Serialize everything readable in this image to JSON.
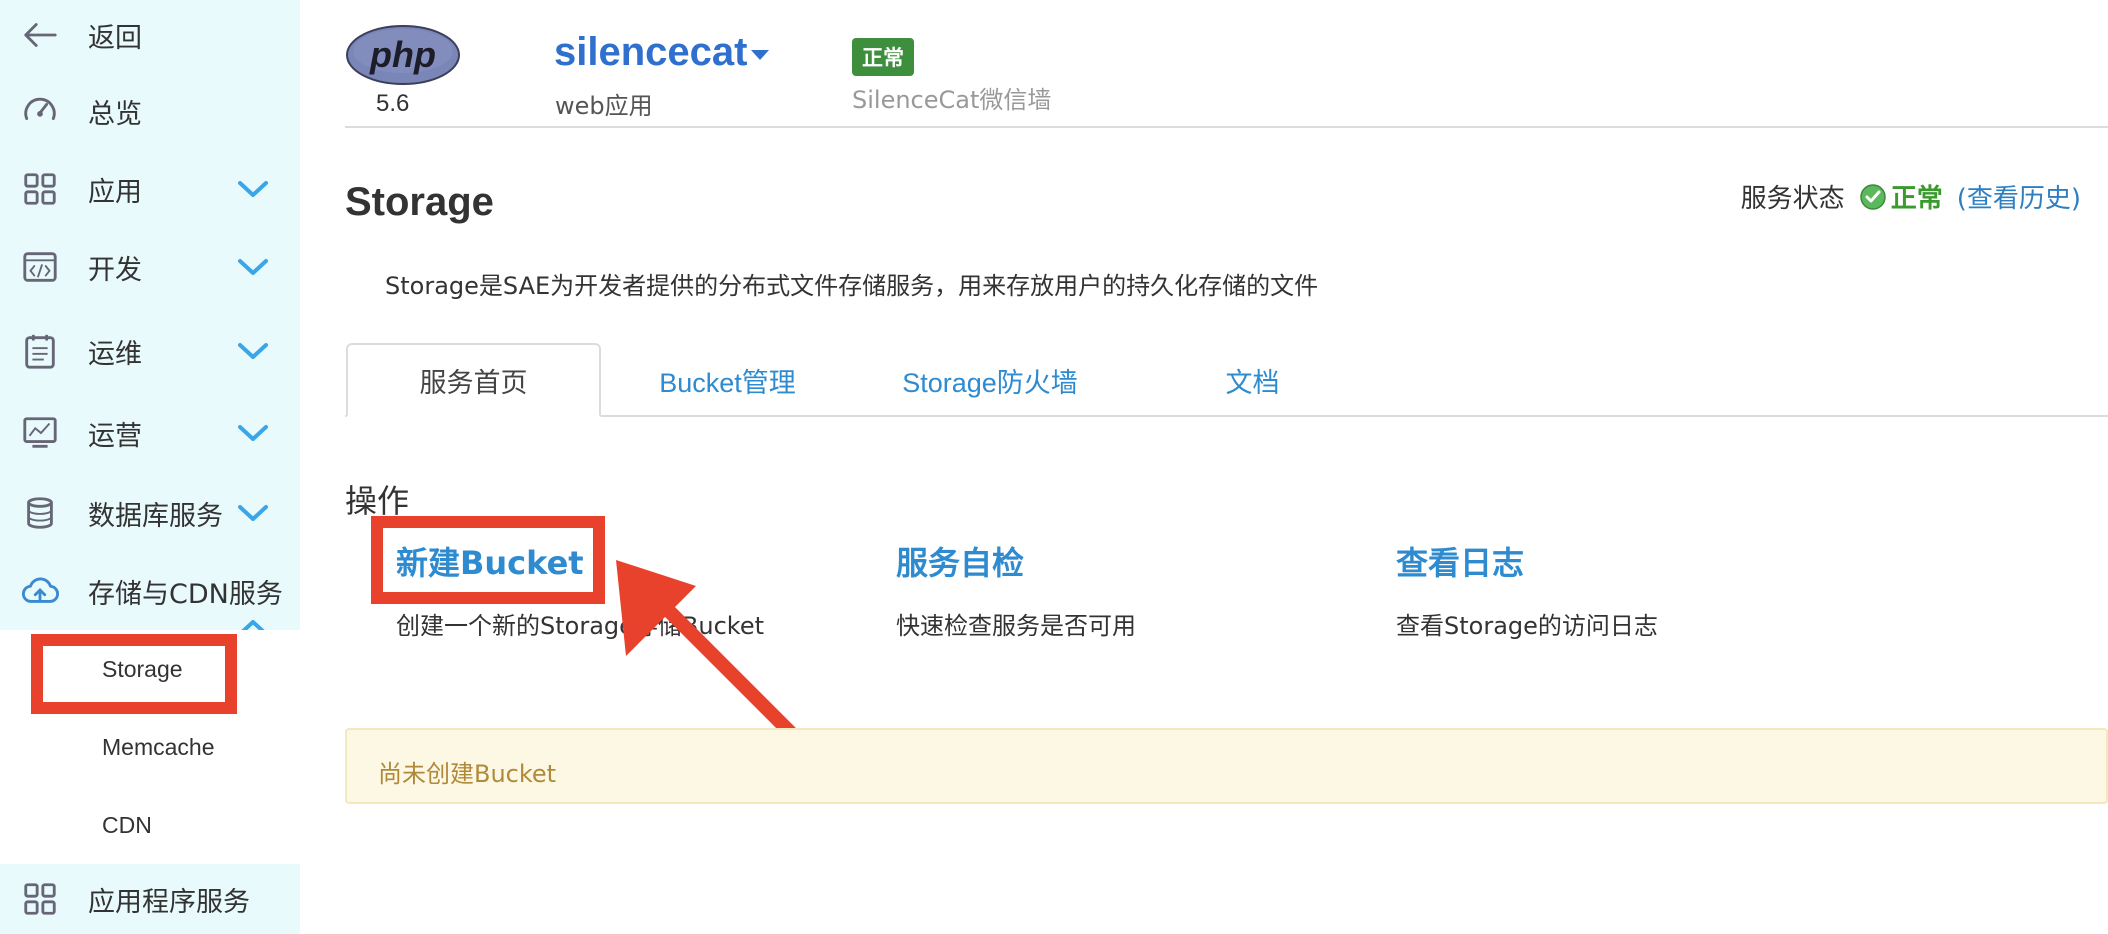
{
  "sidebar": {
    "items": [
      {
        "label": "返回",
        "icon": "back-arrow-icon"
      },
      {
        "label": "总览",
        "icon": "dashboard-gauge-icon"
      },
      {
        "label": "应用",
        "icon": "apps-grid-icon"
      },
      {
        "label": "开发",
        "icon": "code-window-icon"
      },
      {
        "label": "运维",
        "icon": "clipboard-icon"
      },
      {
        "label": "运营",
        "icon": "monitor-chart-icon"
      },
      {
        "label": "数据库服务",
        "icon": "database-icon"
      },
      {
        "label": "存储与CDN服务",
        "icon": "cloud-upload-icon"
      },
      {
        "label": "应用程序服务",
        "icon": "apps-grid-icon"
      }
    ],
    "sub_items": [
      {
        "label": "Storage"
      },
      {
        "label": "Memcache"
      },
      {
        "label": "CDN"
      }
    ]
  },
  "header": {
    "php_logo_text": "php",
    "php_version": "5.6",
    "app_name": "silencecat",
    "app_type": "web应用",
    "status_badge": "正常",
    "app_description": "SilenceCat微信墙"
  },
  "page": {
    "title": "Storage",
    "service_status_label": "服务状态",
    "service_status_value": "正常",
    "view_history": "(查看历史)",
    "intro": "Storage是SAE为开发者提供的分布式文件存储服务，用来存放用户的持久化存储的文件"
  },
  "tabs": [
    {
      "label": "服务首页"
    },
    {
      "label": "Bucket管理"
    },
    {
      "label": "Storage防火墙"
    },
    {
      "label": "文档"
    }
  ],
  "operations": {
    "title": "操作",
    "items": [
      {
        "title": "新建Bucket",
        "desc": "创建一个新的Storage存储Bucket"
      },
      {
        "title": "服务自检",
        "desc": "快速检查服务是否可用"
      },
      {
        "title": "查看日志",
        "desc": "查看Storage的访问日志"
      }
    ]
  },
  "notice": {
    "text": "尚未创建Bucket"
  },
  "colors": {
    "sidebar_bg": "#e9fafd",
    "link_blue": "#2e8bd0",
    "app_name_blue": "#2f6fce",
    "ok_green": "#3a9a2e",
    "annotation_red": "#e8412c",
    "notice_bg": "#fcf8e3"
  }
}
